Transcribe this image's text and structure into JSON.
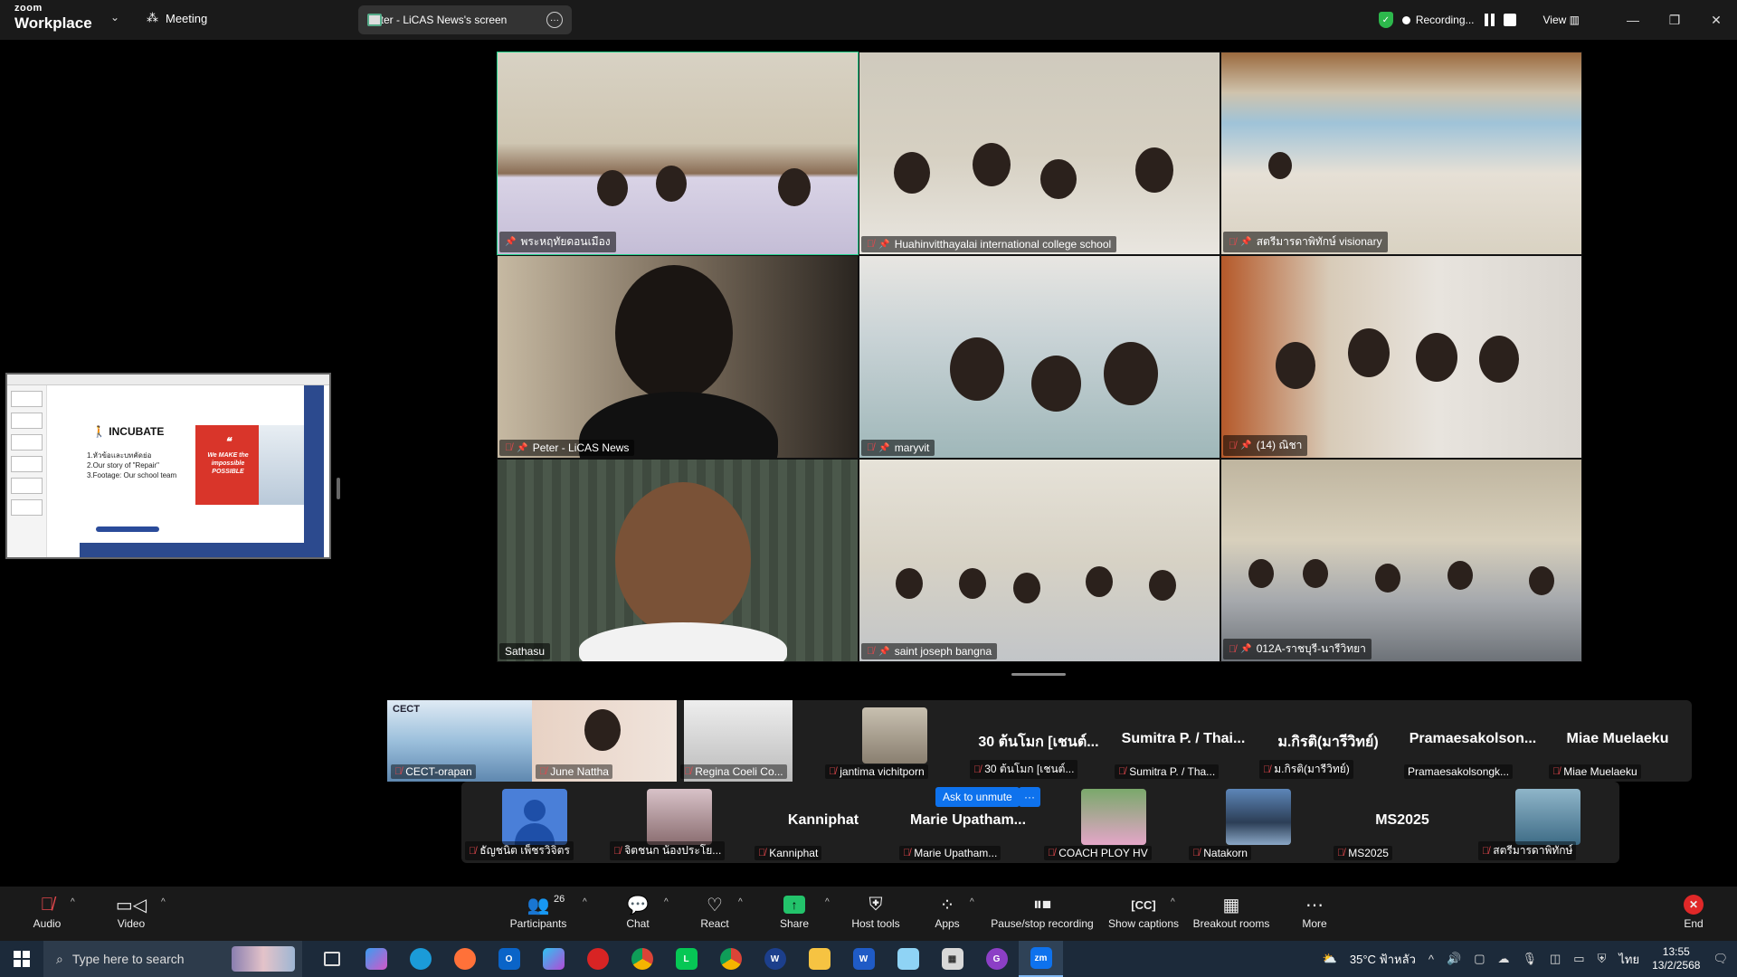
{
  "app": {
    "brand_top": "zoom",
    "brand_bottom": "Workplace",
    "meeting_label": "Meeting",
    "screen_share_label": "Peter - LiCAS News's screen",
    "recording_label": "Recording...",
    "view_label": "View"
  },
  "share_preview": {
    "slide_title": "INCUBATE",
    "slide_items": [
      "1.หัวข้อและบทคัดย่อ",
      "2.Our story of \"Repair\"",
      "3.Footage: Our school team"
    ],
    "slide_quote": "We MAKE the impossible POSSIBLE"
  },
  "tiles": [
    {
      "name": "พระหฤทัยดอนเมือง",
      "muted": false,
      "pinned": true,
      "active": true
    },
    {
      "name": "Huahinvitthayalai international college school",
      "muted": true,
      "pinned": true,
      "active": false
    },
    {
      "name": "สตรีมารดาพิทักษ์ visionary",
      "muted": true,
      "pinned": true,
      "active": false
    },
    {
      "name": "Peter - LiCAS News",
      "muted": true,
      "pinned": true,
      "active": false
    },
    {
      "name": "maryvit",
      "muted": true,
      "pinned": true,
      "active": false
    },
    {
      "name": "(14) ณิชา",
      "muted": true,
      "pinned": true,
      "active": false
    },
    {
      "name": "Sathasu",
      "muted": false,
      "pinned": false,
      "active": false
    },
    {
      "name": "saint joseph bangna",
      "muted": true,
      "pinned": true,
      "active": false
    },
    {
      "name": "012A-ราชบุรี-นารีวิทยา",
      "muted": true,
      "pinned": true,
      "active": false
    }
  ],
  "strip_row1": [
    {
      "name": "CECT-orapan",
      "big": "",
      "muted": true
    },
    {
      "name": "June Nattha",
      "big": "",
      "muted": true
    },
    {
      "name": "Regina Coeli Co...",
      "big": "",
      "muted": true
    },
    {
      "name": "jantima vichitporn",
      "big": "",
      "muted": true
    },
    {
      "name": "30 ต้นโมก [เชนต์...",
      "big": "30 ต้นโมก [เชนต์...",
      "muted": true
    },
    {
      "name": "Sumitra P. / Tha...",
      "big": "Sumitra P. / Thai...",
      "muted": true
    },
    {
      "name": "ม.กิรติ(มารีวิทย์)",
      "big": "ม.กิรติ(มารีวิทย์)",
      "muted": true
    },
    {
      "name": "Pramaesakolsongk...",
      "big": "Pramaesakolson...",
      "muted": false
    },
    {
      "name": "Miae Muelaeku",
      "big": "Miae Muelaeku",
      "muted": true
    }
  ],
  "strip_row2": [
    {
      "name": "ธัญชนิต เพ็ชรวิจิตร",
      "big": "",
      "muted": true
    },
    {
      "name": "จิตชนก น้องประโย...",
      "big": "",
      "muted": true
    },
    {
      "name": "Kanniphat",
      "big": "Kanniphat",
      "muted": true
    },
    {
      "name": "Marie Upatham...",
      "big": "Marie Upatham...",
      "muted": true
    },
    {
      "name": "COACH PLOY HV",
      "big": "",
      "muted": true
    },
    {
      "name": "Natakorn",
      "big": "",
      "muted": true
    },
    {
      "name": "MS2025",
      "big": "MS2025",
      "muted": true
    },
    {
      "name": "สตรีมารดาพิทักษ์",
      "big": "",
      "muted": true
    }
  ],
  "ask_unmute": "Ask to unmute",
  "ask_more": "···",
  "toolbar": {
    "audio": "Audio",
    "video": "Video",
    "participants": "Participants",
    "participants_count": "26",
    "chat": "Chat",
    "react": "React",
    "share": "Share",
    "host_tools": "Host tools",
    "apps": "Apps",
    "pause_recording": "Pause/stop recording",
    "captions": "Show captions",
    "breakout": "Breakout rooms",
    "more": "More",
    "end": "End"
  },
  "taskbar": {
    "search_placeholder": "Type here to search",
    "weather": "35°C ฟ้าหลัว",
    "lang": "ไทย",
    "time": "13:55",
    "date": "13/2/2568"
  },
  "colors": {
    "active_speaker": "#23d18b",
    "muted_icon": "#e5484d",
    "zoom_blue": "#0e72ed",
    "share_green": "#23c36b",
    "end_red": "#e02828"
  }
}
